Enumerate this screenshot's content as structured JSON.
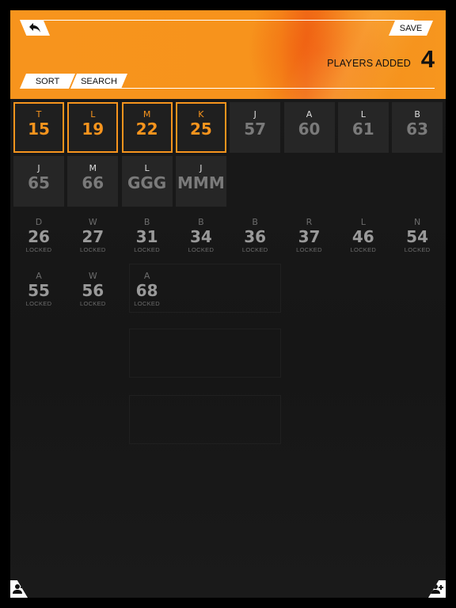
{
  "header": {
    "save_label": "SAVE",
    "sort_label": "SORT",
    "search_label": "SEARCH",
    "players_added_label": "PLAYERS ADDED",
    "players_added_count": "4"
  },
  "tiles": [
    {
      "letter": "T",
      "number": "15",
      "state": "selected"
    },
    {
      "letter": "L",
      "number": "19",
      "state": "selected"
    },
    {
      "letter": "M",
      "number": "22",
      "state": "selected"
    },
    {
      "letter": "K",
      "number": "25",
      "state": "selected"
    },
    {
      "letter": "J",
      "number": "57",
      "state": "available"
    },
    {
      "letter": "A",
      "number": "60",
      "state": "available"
    },
    {
      "letter": "L",
      "number": "61",
      "state": "available"
    },
    {
      "letter": "B",
      "number": "63",
      "state": "available"
    },
    {
      "letter": "J",
      "number": "65",
      "state": "available"
    },
    {
      "letter": "M",
      "number": "66",
      "state": "available"
    },
    {
      "letter": "L",
      "number": "GGG",
      "state": "available"
    },
    {
      "letter": "J",
      "number": "MMM",
      "state": "available"
    },
    {
      "letter": "D",
      "number": "26",
      "state": "locked"
    },
    {
      "letter": "W",
      "number": "27",
      "state": "locked"
    },
    {
      "letter": "B",
      "number": "31",
      "state": "locked"
    },
    {
      "letter": "B",
      "number": "34",
      "state": "locked"
    },
    {
      "letter": "B",
      "number": "36",
      "state": "locked"
    },
    {
      "letter": "R",
      "number": "37",
      "state": "locked"
    },
    {
      "letter": "L",
      "number": "46",
      "state": "locked"
    },
    {
      "letter": "N",
      "number": "54",
      "state": "locked"
    },
    {
      "letter": "A",
      "number": "55",
      "state": "locked"
    },
    {
      "letter": "W",
      "number": "56",
      "state": "locked"
    },
    {
      "letter": "A",
      "number": "68",
      "state": "locked"
    }
  ],
  "locked_label": "LOCKED",
  "colors": {
    "accent": "#f7941d",
    "background": "#161616",
    "tile": "#262626"
  },
  "icons": {
    "back": "back-arrow-icon",
    "remove_player": "remove-player-icon",
    "add_player": "add-player-icon"
  }
}
